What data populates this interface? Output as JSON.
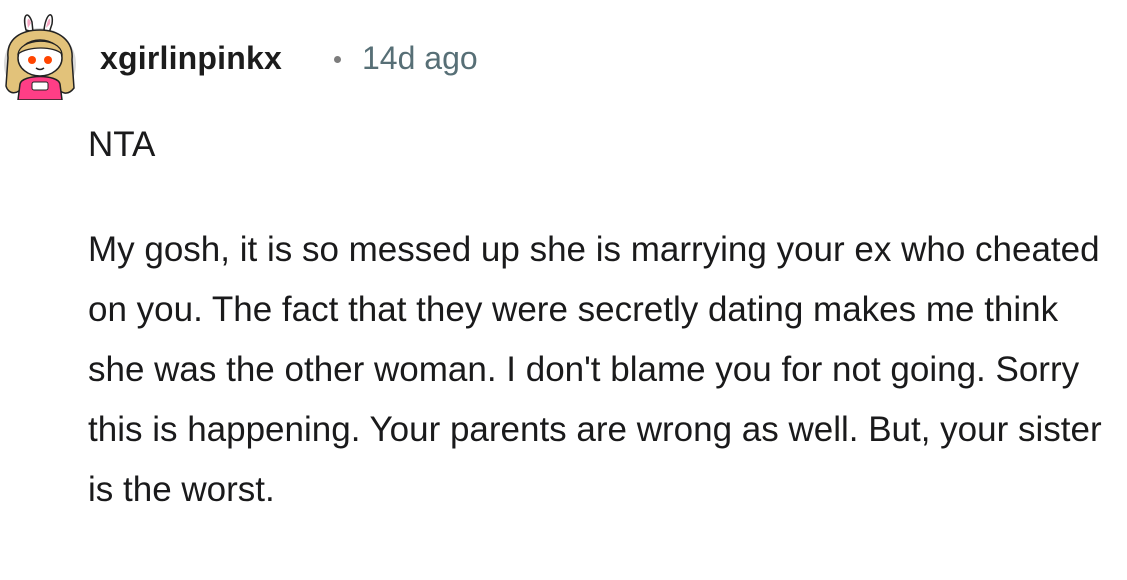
{
  "comment": {
    "author": "xgirlinpinkx",
    "separator": "•",
    "timestamp": "14d ago",
    "verdict": "NTA",
    "body": "My gosh, it is so messed up she is marrying your ex who cheated on you. The fact that they were secretly dating makes me think she was the other woman. I don't blame you for not going. Sorry this is happening. Your parents are wrong as well. But, your sister is the worst."
  },
  "avatar": {
    "icon": "snoo-bunny-avatar-icon",
    "background_color": "#d9d9d9",
    "hair_color": "#e2c27a",
    "shirt_color": "#ff3e86",
    "eye_color": "#ff4500"
  },
  "colors": {
    "text": "#1a1a1b",
    "username": "#1c1c1c",
    "timestamp": "#576f76",
    "background": "#ffffff"
  }
}
